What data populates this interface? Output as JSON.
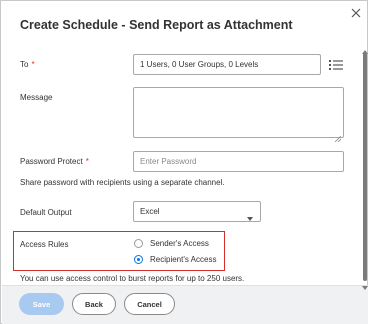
{
  "dialog": {
    "title": "Create Schedule - Send Report as Attachment",
    "close_icon": "close-icon"
  },
  "form": {
    "to": {
      "label": "To",
      "required_mark": "*",
      "value": "1 Users, 0 User Groups, 0 Levels",
      "icon": "list-icon"
    },
    "message": {
      "label": "Message",
      "value": ""
    },
    "password": {
      "label": "Password Protect",
      "required_mark": "*",
      "placeholder": "Enter Password",
      "hint": "Share password with recipients using a separate channel."
    },
    "default_output": {
      "label": "Default Output",
      "selected": "Excel",
      "icon": "chevron-down-icon"
    },
    "access_rules": {
      "label": "Access Rules",
      "options": [
        {
          "label": "Sender's Access",
          "checked": false
        },
        {
          "label": "Recipient's Access",
          "checked": true
        }
      ],
      "hint": "You can use access control to burst reports for up to 250 users.",
      "highlight_color": "#d32f2f"
    }
  },
  "footer": {
    "save_label": "Save",
    "back_label": "Back",
    "cancel_label": "Cancel"
  },
  "colors": {
    "accent": "#0875e1",
    "save_disabled_bg": "#a8c9f0",
    "required": "#de2e21",
    "footer_bg": "#f0f1f2"
  }
}
